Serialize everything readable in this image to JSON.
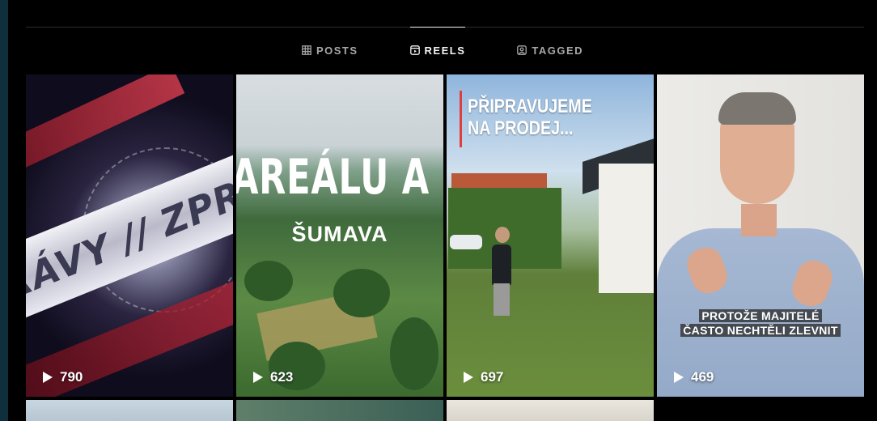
{
  "tabs": [
    {
      "label": "POSTS",
      "icon": "grid-icon",
      "active": false
    },
    {
      "label": "REELS",
      "icon": "reels-icon",
      "active": true
    },
    {
      "label": "TAGGED",
      "icon": "tagged-icon",
      "active": false
    }
  ],
  "reels": [
    {
      "views": "790",
      "overlay_text": "RÁVY // ZPRÁ"
    },
    {
      "views": "623",
      "overlay_title": "AREÁLU A P",
      "overlay_subtitle": "ŠUMAVA"
    },
    {
      "views": "697",
      "overlay_text": "PŘIPRAVUJEME NA PRODEJ..."
    },
    {
      "views": "469",
      "caption_line1": "PROTOŽE MAJITELÉ",
      "caption_line2": "ČASTO NECHTĚLI ZLEVNIT"
    }
  ],
  "colors": {
    "background": "#0f2f3d",
    "content": "#000000",
    "tab_active": "#f5f5f5",
    "tab_inactive": "#a8a8a8"
  }
}
